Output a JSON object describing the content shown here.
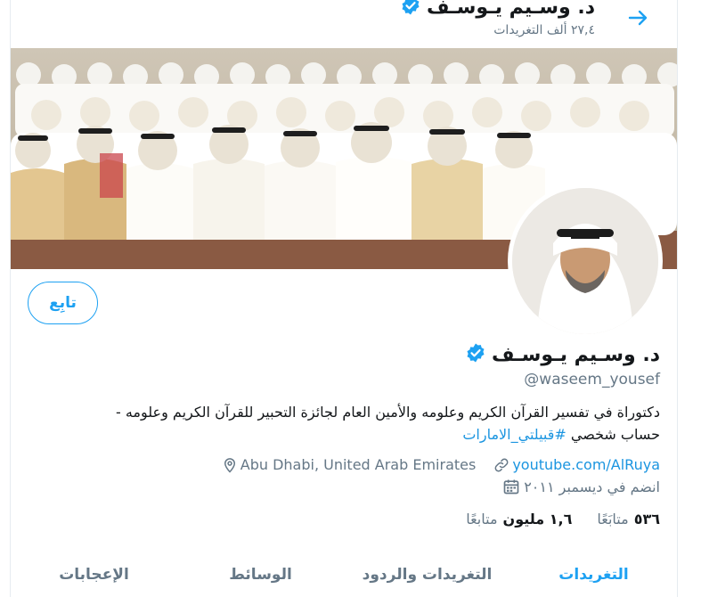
{
  "header": {
    "name": "د. وسـيم يـوسـف",
    "tweet_count": "٢٧,٤ ألف التغريدات",
    "back_icon": "arrow-right-icon"
  },
  "colors": {
    "accent": "#1da1f2",
    "link": "#1b95e0",
    "muted": "#657786",
    "text": "#14171a",
    "verified": "#1da1f2"
  },
  "follow_button": {
    "label": "تابِع"
  },
  "profile": {
    "name": "د. وسـيم يـوسـف",
    "handle": "@waseem_yousef",
    "bio_line1": "دكتوراة في تفسير القرآن الكريم وعلومه والأمين العام لجائزة التحبير للقرآن الكريم وعلومه -",
    "bio_line2_prefix": "حساب شخصي ",
    "bio_hashtag": "#قبيلتي_الامارات",
    "location": "Abu Dhabi, United Arab Emirates",
    "website": "youtube.com/AlRuya",
    "joined": "انضم في ديسمبر ٢٠١١"
  },
  "stats": {
    "following_count": "٥٣٦",
    "following_label": "متابَعًا",
    "followers_count": "١,٦ مليون",
    "followers_label": "متابعًا"
  },
  "tabs": [
    {
      "label": "التغريدات",
      "active": true
    },
    {
      "label": "التغريدات والردود",
      "active": false
    },
    {
      "label": "الوسائط",
      "active": false
    },
    {
      "label": "الإعجابات",
      "active": false
    }
  ]
}
